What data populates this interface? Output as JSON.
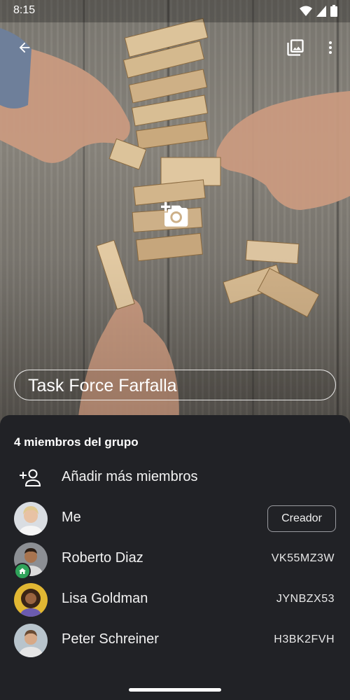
{
  "status_bar": {
    "time": "8:15"
  },
  "group": {
    "name": "Task Force Farfalla"
  },
  "members": {
    "title": "4 miembros del grupo",
    "add_label": "Añadir más miembros",
    "list": [
      {
        "name": "Me",
        "badge": "Creador",
        "code": ""
      },
      {
        "name": "Roberto Diaz",
        "code": "VK55MZ3W"
      },
      {
        "name": "Lisa Goldman",
        "code": "JYNBZX53"
      },
      {
        "name": "Peter Schreiner",
        "code": "H3BK2FVH"
      }
    ]
  },
  "icons": {
    "back": "arrow-back-icon",
    "gallery": "photo-library-icon",
    "more": "more-vert-icon",
    "camera": "add-camera-icon",
    "add_person": "person-add-icon",
    "home": "home-icon"
  },
  "colors": {
    "sheet_bg": "#212226",
    "badge_green": "#2fa35a"
  }
}
